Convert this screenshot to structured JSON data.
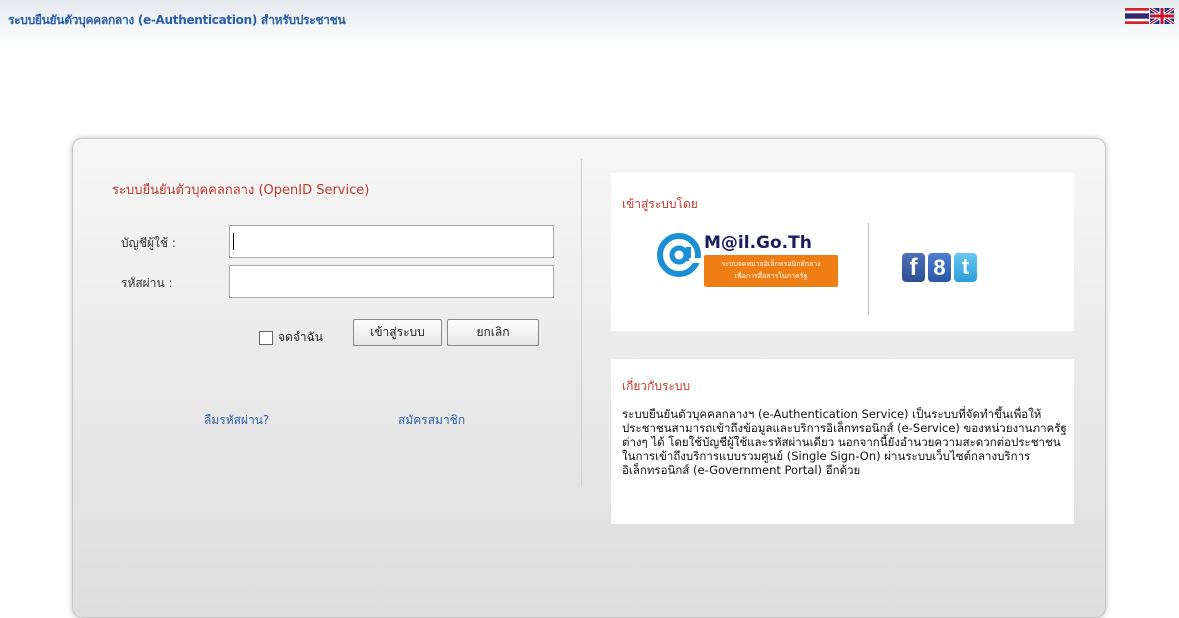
{
  "header": {
    "title": "ระบบยืนยันตัวบุคคลกลาง (e-Authentication) สำหรับประชาชน",
    "flags": [
      {
        "name": "thai-flag-icon"
      },
      {
        "name": "uk-flag-icon"
      }
    ]
  },
  "login": {
    "title": "ระบบยืนยันตัวบุคคลกลาง (OpenID Service)",
    "username_label": "บัญชีผู้ใช้ :",
    "password_label": "รหัสผ่าน :",
    "username_value": "",
    "password_value": "",
    "remember_label": "จดจำฉัน",
    "login_button": "เข้าสู่ระบบ",
    "cancel_button": "ยกเลิก",
    "forgot_link": "ลืมรหัสผ่าน?",
    "register_link": "สมัครสมาชิก"
  },
  "signin_with": {
    "title": "เข้าสู่ระบบโดย",
    "mail_logo_text": "M@il.Go.Th",
    "mail_tagline_1": "ระบบจดหมายอิเล็กทรอนิกส์กลาง",
    "mail_tagline_2": "เพื่อการสื่อสารในภาครัฐ",
    "social": [
      {
        "name": "facebook-icon",
        "glyph": "f"
      },
      {
        "name": "google-icon",
        "glyph": "8"
      },
      {
        "name": "twitter-icon",
        "glyph": "t"
      }
    ]
  },
  "about": {
    "title": "เกี่ยวกับระบบ",
    "text": "ระบบยืนยันตัวบุคคลกลางฯ (e-Authentication Service) เป็นระบบที่จัดทำขึ้นเพื่อให้ประชาชนสามารถเข้าถึงข้อมูลและบริการอิเล็กทรอนิกส์ (e-Service) ของหน่วยงานภาครัฐต่างๆ ได้ โดยใช้บัญชีผู้ใช้และรหัสผ่านเดียว นอกจากนี้ยังอำนวยความสะดวกต่อประชาชนในการเข้าถึงบริการแบบรวมศูนย์ (Single Sign-On) ผ่านระบบเว็บไซต์กลางบริการอิเล็กทรอนิกส์ (e-Government Portal) อีกด้วย"
  },
  "colors": {
    "title_blue": "#2a5fa8",
    "title_red": "#c0392b",
    "mail_orange": "#ee7d14"
  }
}
